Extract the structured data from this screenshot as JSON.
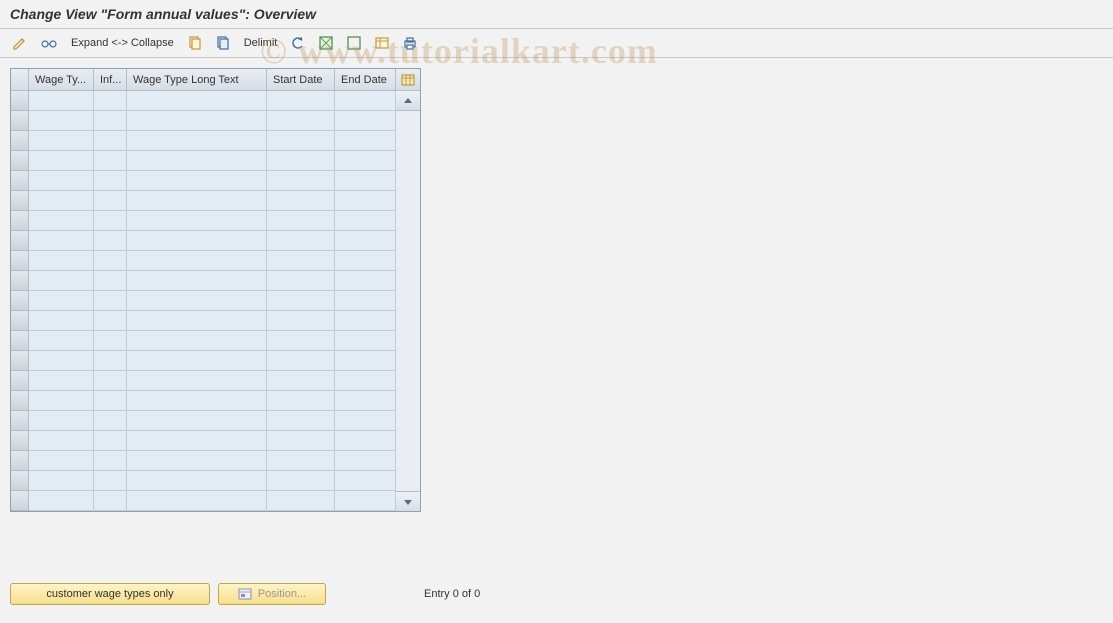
{
  "page_title": "Change View \"Form annual values\": Overview",
  "toolbar": {
    "expand_collapse_label": "Expand <-> Collapse",
    "delimit_label": "Delimit"
  },
  "grid": {
    "columns": [
      "Wage Ty...",
      "Inf...",
      "Wage Type Long Text",
      "Start Date",
      "End Date"
    ],
    "row_count": 21
  },
  "buttons": {
    "customer_wage_types_only": "customer wage types only",
    "position": "Position..."
  },
  "status": {
    "entry_text": "Entry 0 of 0"
  },
  "watermark": "© www.tutorialkart.com"
}
